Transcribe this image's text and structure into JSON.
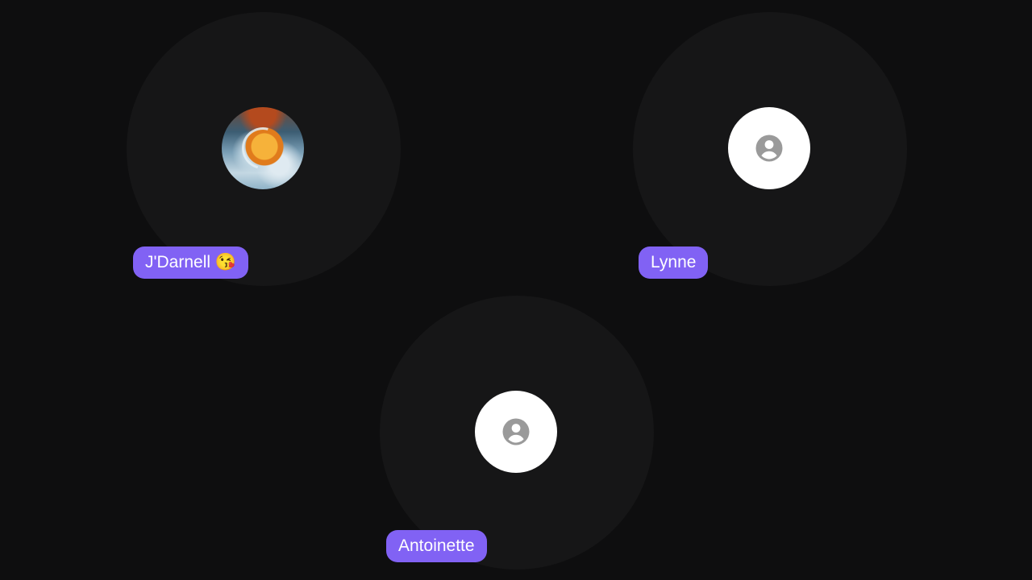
{
  "participants": [
    {
      "name": "J'Darnell 😘",
      "avatar": "photo"
    },
    {
      "name": "Lynne",
      "avatar": "person-icon"
    },
    {
      "name": "Antoinette",
      "avatar": "person-icon"
    }
  ],
  "colors": {
    "background": "#0e0e0f",
    "tile_halo": "#161617",
    "name_pill": "#8162f4",
    "person_icon": "#9a9a9a"
  }
}
